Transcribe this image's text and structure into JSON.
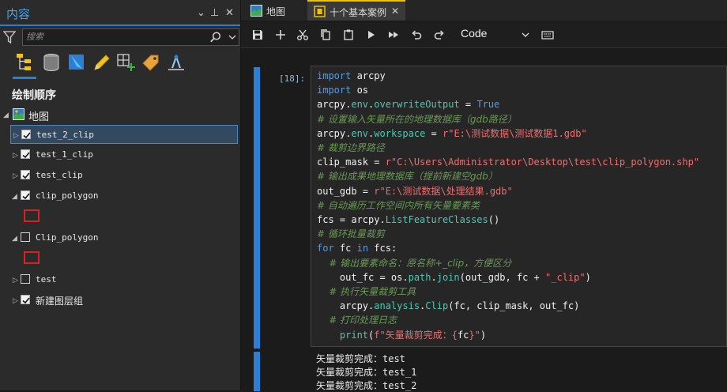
{
  "contents_pane": {
    "title": "内容",
    "controls": {
      "menu": "⌄",
      "pin": "⊥",
      "close": "✕"
    },
    "search": {
      "placeholder": "搜索"
    },
    "section_title": "绘制顺序",
    "map_label": "地图",
    "layers": [
      {
        "label": "test_2_clip",
        "checked": true,
        "selected": true
      },
      {
        "label": "test_1_clip",
        "checked": true
      },
      {
        "label": "test_clip",
        "checked": true
      },
      {
        "label": "clip_polygon",
        "checked": true,
        "expanded": true
      },
      {
        "label": "Clip_polygon",
        "checked": false,
        "expanded": true
      },
      {
        "label": "test",
        "checked": false
      },
      {
        "label": "新建图层组",
        "checked": true
      }
    ]
  },
  "tabs": [
    {
      "label": "地图"
    },
    {
      "label": "十个基本案例",
      "active": true,
      "close": "✕"
    }
  ],
  "toolbar": {
    "cell_type": "Code"
  },
  "cell": {
    "prompt": "[18]:",
    "code": [
      [
        [
          "kw",
          "import"
        ],
        [
          "op",
          " arcpy"
        ]
      ],
      [
        [
          "kw",
          "import"
        ],
        [
          "op",
          " os"
        ]
      ],
      [
        [
          "op",
          "arcpy."
        ],
        [
          "at",
          "env"
        ],
        [
          "op",
          "."
        ],
        [
          "at",
          "overwriteOutput"
        ],
        [
          "op",
          " = "
        ],
        [
          "kw",
          "True"
        ]
      ],
      [
        [
          "cmt",
          "# 设置输入矢量所在的地理数据库（gdb路径）"
        ]
      ],
      [
        [
          "op",
          "arcpy."
        ],
        [
          "at",
          "env"
        ],
        [
          "op",
          "."
        ],
        [
          "at",
          "workspace"
        ],
        [
          "op",
          " = "
        ],
        [
          "st",
          "r\"E:\\测试数据\\测试数据1.gdb\""
        ]
      ],
      [
        [
          "cmt",
          "# 裁剪边界路径"
        ]
      ],
      [
        [
          "op",
          "clip_mask = "
        ],
        [
          "st",
          "r\"C:\\Users\\Administrator\\Desktop\\test\\clip_polygon.shp\""
        ]
      ],
      [
        [
          "cmt",
          "# 输出成果地理数据库（提前新建空gdb）"
        ]
      ],
      [
        [
          "op",
          "out_gdb = "
        ],
        [
          "st",
          "r\"E:\\测试数据\\处理结果.gdb\""
        ]
      ],
      [
        [
          "cmt",
          "# 自动遍历工作空间内所有矢量要素类"
        ]
      ],
      [
        [
          "op",
          "fcs = arcpy."
        ],
        [
          "at",
          "ListFeatureClasses"
        ],
        [
          "op",
          "()"
        ]
      ],
      [
        [
          "cmt",
          "# 循环批量裁剪"
        ]
      ],
      [
        [
          "kw",
          "for"
        ],
        [
          "op",
          " fc "
        ],
        [
          "kw",
          "in"
        ],
        [
          "op",
          " fcs:"
        ]
      ],
      [
        [
          "cmt",
          "    # 输出要素命名：原名称+_clip，方便区分"
        ]
      ],
      [
        [
          "op",
          "    out_fc = os."
        ],
        [
          "at",
          "path"
        ],
        [
          "op",
          "."
        ],
        [
          "at",
          "join"
        ],
        [
          "op",
          "(out_gdb, fc + "
        ],
        [
          "st",
          "\"_clip\""
        ],
        [
          "op",
          ")"
        ]
      ],
      [
        [
          "cmt",
          "    # 执行矢量裁剪工具"
        ]
      ],
      [
        [
          "op",
          "    arcpy."
        ],
        [
          "at",
          "analysis"
        ],
        [
          "op",
          "."
        ],
        [
          "at",
          "Clip"
        ],
        [
          "op",
          "(fc, clip_mask, out_fc)"
        ]
      ],
      [
        [
          "cmt",
          "    # 打印处理日志"
        ]
      ],
      [
        [
          "bi",
          "    print"
        ],
        [
          "op",
          "("
        ],
        [
          "st",
          "f\"矢量裁剪完成：{"
        ],
        [
          "op",
          "fc"
        ],
        [
          "st",
          "}\""
        ],
        [
          "op",
          ")"
        ]
      ]
    ],
    "output": [
      "矢量裁剪完成：test",
      "矢量裁剪完成：test_1",
      "矢量裁剪完成：test_2"
    ]
  },
  "colors": {
    "accent": "#2b7fd4",
    "keyword": "#4e9eef",
    "attribute": "#4ec9b0",
    "string": "#ee6f6f",
    "comment": "#6a9955",
    "tab_active": "#f2c200",
    "symbol_outline": "#d42424"
  },
  "icons": {
    "filter": "funnel-icon",
    "search": "magnifier-icon",
    "views": [
      "drawing-order-icon",
      "data-source-icon",
      "selection-icon",
      "editing-icon",
      "snapping-icon",
      "labeling-icon",
      "charts-icon"
    ]
  }
}
